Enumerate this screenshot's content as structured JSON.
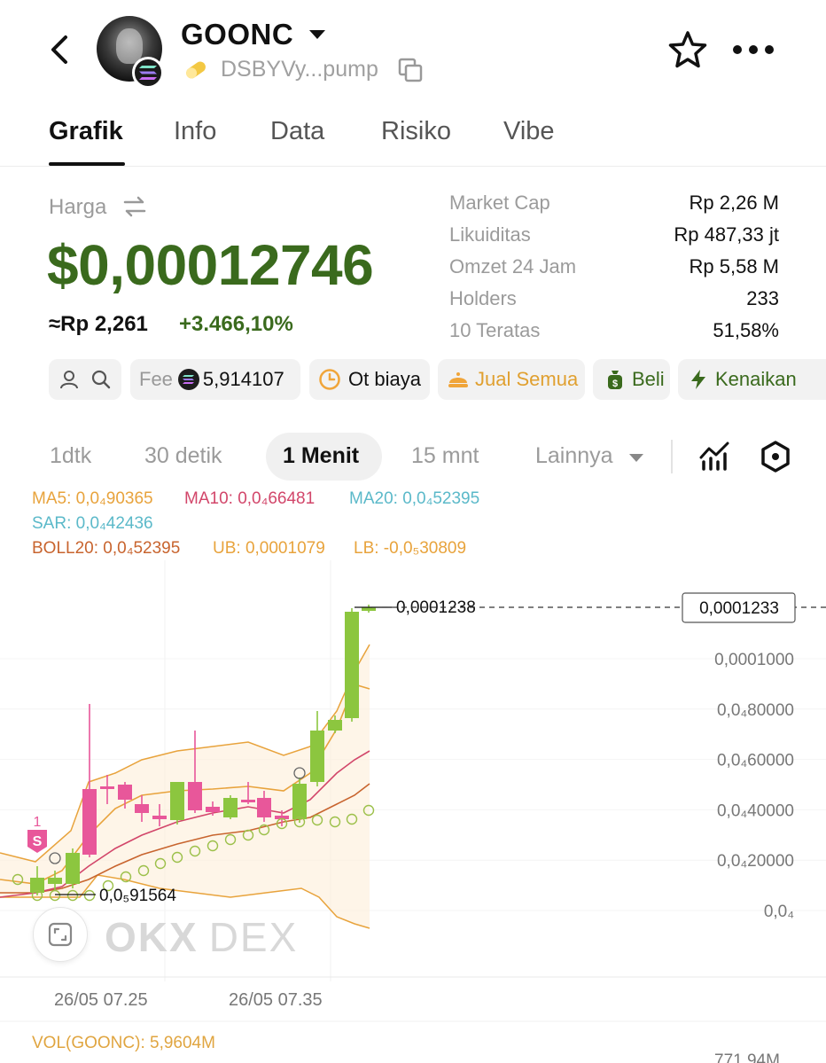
{
  "header": {
    "token_name": "GOONC",
    "address": "DSBYVy...pump"
  },
  "tabs": [
    {
      "label": "Grafik",
      "active": true
    },
    {
      "label": "Info"
    },
    {
      "label": "Data"
    },
    {
      "label": "Risiko"
    },
    {
      "label": "Vibe"
    }
  ],
  "price": {
    "label": "Harga",
    "usd": "$0,00012746",
    "idr": "≈Rp 2,261",
    "change": "+3.466,10%"
  },
  "stats": [
    {
      "label": "Market Cap",
      "value": "Rp 2,26 M"
    },
    {
      "label": "Likuiditas",
      "value": "Rp 487,33 jt"
    },
    {
      "label": "Omzet 24 Jam",
      "value": "Rp 5,58 M"
    },
    {
      "label": "Holders",
      "value": "233"
    },
    {
      "label": "10 Teratas",
      "value": "51,58%"
    }
  ],
  "chips": {
    "fee_label": "Fee",
    "fee_value": "5,914107",
    "ot_biaya": "Ot biaya",
    "jual_semua": "Jual Semua",
    "beli": "Beli",
    "kenaikan": "Kenaikan"
  },
  "timeframes": {
    "items": [
      "1dtk",
      "30 detik",
      "1 Menit",
      "15 mnt"
    ],
    "active": "1 Menit",
    "more": "Lainnya"
  },
  "indicators": {
    "ma5": "MA5: 0,0₄90365",
    "ma10": "MA10: 0,0₄66481",
    "ma20": "MA20: 0,0₄52395",
    "sar": "SAR: 0,0₄42436",
    "boll": "BOLL20: 0,0₄52395",
    "ub": "UB: 0,0001079",
    "lb": "LB: -0,0₅30809"
  },
  "chart_data": {
    "type": "candlestick",
    "y_axis_labels": [
      "0,0001000",
      "0,0₄80000",
      "0,0₄60000",
      "0,0₄40000",
      "0,0₄20000",
      "0,0₄"
    ],
    "current_price_label": "0,0001233",
    "high_marker": "0,0001238",
    "low_marker": "0,0₅91564",
    "x_axis_labels": [
      "26/05 07.25",
      "26/05 07.35"
    ],
    "sell_marker": {
      "count": "1",
      "label": "S"
    },
    "colors": {
      "up": "#8cc63f",
      "down": "#e8579a",
      "ma5": "#e8a33c",
      "ma10": "#d2466a",
      "ma20": "#5bb9c9",
      "boll": "#c8642e",
      "ub": "#e8a33c",
      "sar": "#9cc04a",
      "current_line": "#333333"
    }
  },
  "volume": {
    "label": "VOL(GOONC): 5,9604M",
    "right_value": "771,94M"
  },
  "watermark": {
    "brand": "OKX",
    "suffix": "DEX"
  }
}
